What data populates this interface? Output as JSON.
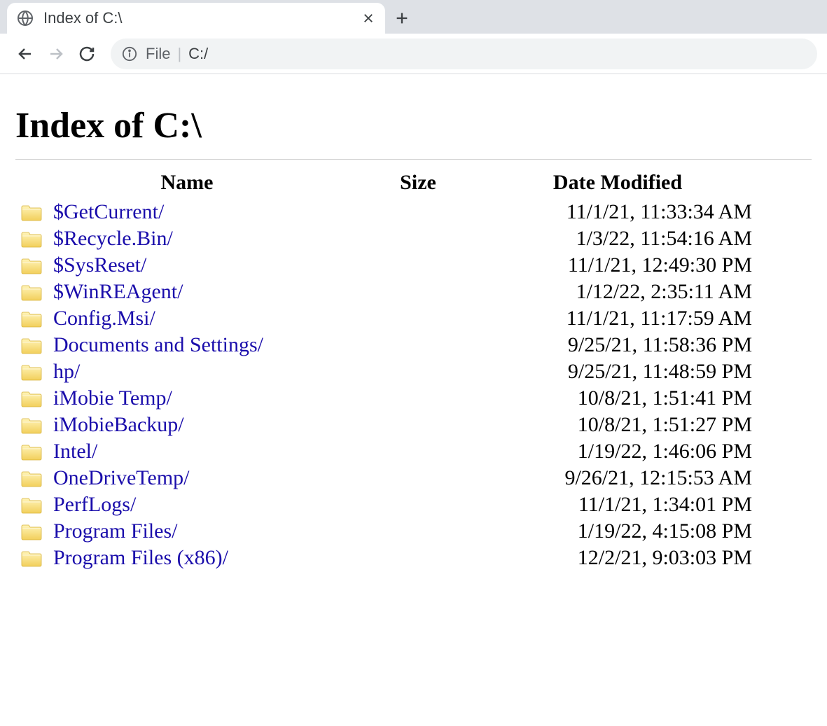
{
  "tab": {
    "title": "Index of C:\\"
  },
  "address": {
    "protocol": "File",
    "path": "C:/"
  },
  "page": {
    "heading": "Index of C:\\"
  },
  "columns": {
    "name": "Name",
    "size": "Size",
    "date": "Date Modified"
  },
  "entries": [
    {
      "name": "$GetCurrent/",
      "size": "",
      "date": "11/1/21, 11:33:34 AM"
    },
    {
      "name": "$Recycle.Bin/",
      "size": "",
      "date": "1/3/22, 11:54:16 AM"
    },
    {
      "name": "$SysReset/",
      "size": "",
      "date": "11/1/21, 12:49:30 PM"
    },
    {
      "name": "$WinREAgent/",
      "size": "",
      "date": "1/12/22, 2:35:11 AM"
    },
    {
      "name": "Config.Msi/",
      "size": "",
      "date": "11/1/21, 11:17:59 AM"
    },
    {
      "name": "Documents and Settings/",
      "size": "",
      "date": "9/25/21, 11:58:36 PM"
    },
    {
      "name": "hp/",
      "size": "",
      "date": "9/25/21, 11:48:59 PM"
    },
    {
      "name": "iMobie Temp/",
      "size": "",
      "date": "10/8/21, 1:51:41 PM"
    },
    {
      "name": "iMobieBackup/",
      "size": "",
      "date": "10/8/21, 1:51:27 PM"
    },
    {
      "name": "Intel/",
      "size": "",
      "date": "1/19/22, 1:46:06 PM"
    },
    {
      "name": "OneDriveTemp/",
      "size": "",
      "date": "9/26/21, 12:15:53 AM"
    },
    {
      "name": "PerfLogs/",
      "size": "",
      "date": "11/1/21, 1:34:01 PM"
    },
    {
      "name": "Program Files/",
      "size": "",
      "date": "1/19/22, 4:15:08 PM"
    },
    {
      "name": "Program Files (x86)/",
      "size": "",
      "date": "12/2/21, 9:03:03 PM"
    }
  ]
}
